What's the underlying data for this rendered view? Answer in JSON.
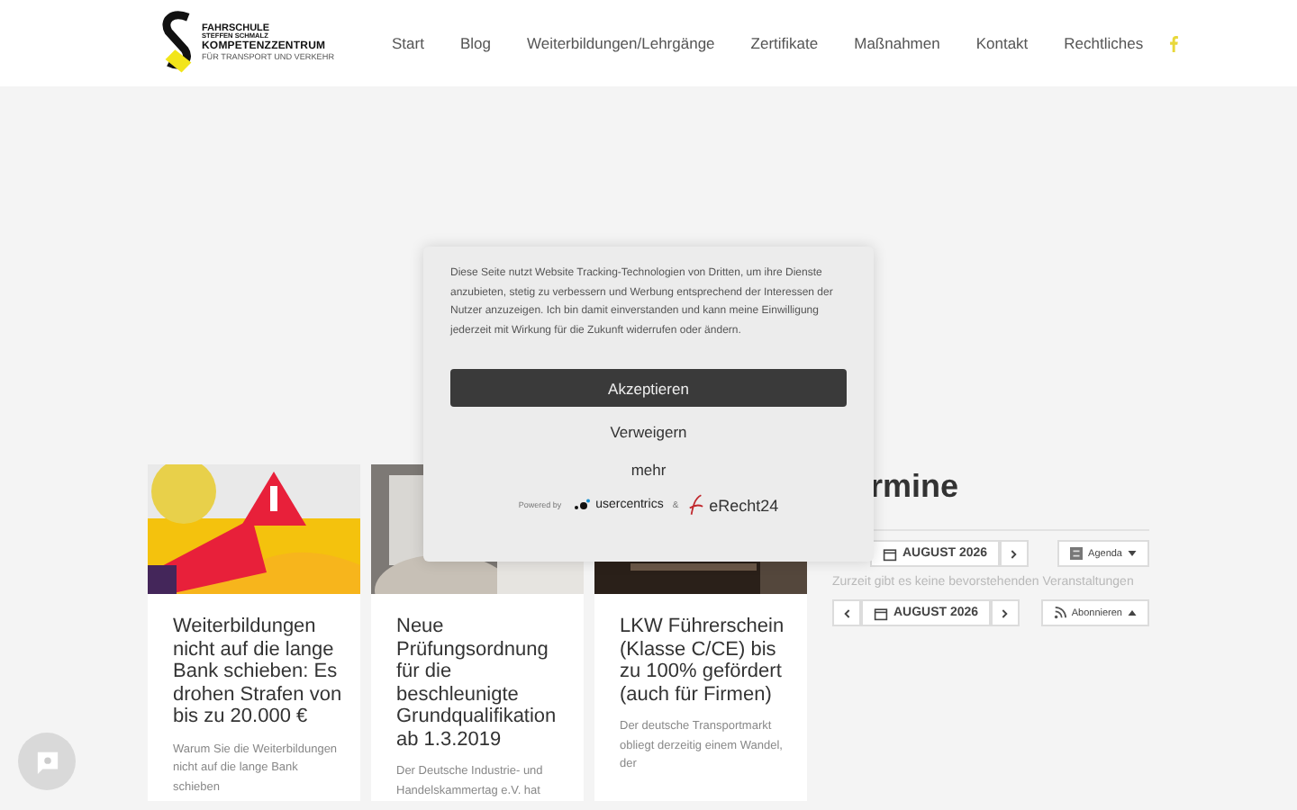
{
  "header": {
    "logo": {
      "lines": [
        "FAHRSCHULE",
        "STEFFEN SCHMALZ",
        "KOMPETENZZENTRUM",
        "FÜR TRANSPORT UND VERKEHR"
      ]
    },
    "nav": [
      {
        "label": "Start"
      },
      {
        "label": "Blog"
      },
      {
        "label": "Weiterbildungen/Lehrgänge"
      },
      {
        "label": "Zertifikate"
      },
      {
        "label": "Maßnahmen"
      },
      {
        "label": "Kontakt"
      },
      {
        "label": "Rechtliches"
      }
    ]
  },
  "posts": [
    {
      "title": "Weiterbildungen nicht auf die lange Bank schieben: Es drohen Strafen von bis zu 20.000 €",
      "excerpt": "Warum Sie die Weiterbildungen nicht auf die lange Bank schieben"
    },
    {
      "title": "Neue Prüfungsordnung für die beschleunigte Grundqualifikation ab 1.3.2019",
      "excerpt": "Der Deutsche Industrie- und Handelskammertag e.V. hat"
    },
    {
      "title": "LKW Führerschein (Klasse C/CE) bis zu 100% gefördert (auch für Firmen)",
      "excerpt": "Der deutsche Transportmarkt obliegt derzeitig einem Wandel, der"
    }
  ],
  "events": {
    "heading": "rmine",
    "toolbar_top": {
      "date": "AUGUST 2026",
      "view": "Agenda"
    },
    "message": "Zurzeit gibt es keine bevorstehenden Veranstaltungen",
    "toolbar_bottom": {
      "date": "AUGUST 2026",
      "action": "Abonnieren"
    }
  },
  "consent": {
    "text": "Diese Seite nutzt Website Tracking-Technologien von Dritten, um ihre Dienste anzubieten, stetig zu verbessern und Werbung entsprechend der Interessen der Nutzer anzuzeigen. Ich bin damit einverstanden und kann meine Einwilligung jederzeit mit Wirkung für die Zukunft widerrufen oder ändern.",
    "accept": "Akzeptieren",
    "deny": "Verweigern",
    "more": "mehr",
    "powered_by": "Powered by",
    "brand_one": "usercentrics",
    "ampersand": "&",
    "brand_two": "eRecht24"
  }
}
